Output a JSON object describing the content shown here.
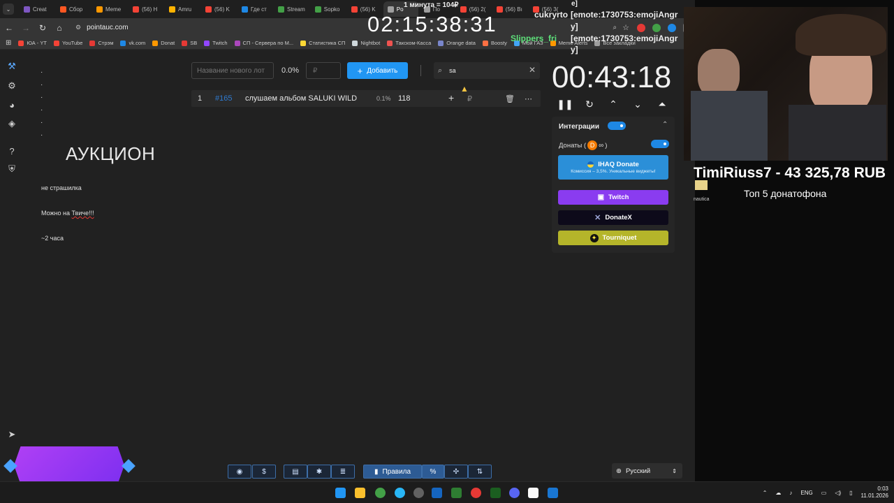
{
  "tabs": [
    {
      "label": "Creat",
      "color": "#7e57c2"
    },
    {
      "label": "Сбор",
      "color": "#ff5722"
    },
    {
      "label": "Meme",
      "color": "#ff9800"
    },
    {
      "label": "(56) H",
      "color": "#f44336"
    },
    {
      "label": "Amru",
      "color": "#ffb300"
    },
    {
      "label": "(56) K",
      "color": "#f44336"
    },
    {
      "label": "Где ст",
      "color": "#1e88e5"
    },
    {
      "label": "Stream",
      "color": "#43a047"
    },
    {
      "label": "Sopko",
      "color": "#43a047"
    },
    {
      "label": "(56) K",
      "color": "#f44336"
    },
    {
      "label": "Po",
      "color": "#9e9e9e"
    },
    {
      "label": "По",
      "color": "#9e9e9e"
    },
    {
      "label": "(56) 2(",
      "color": "#f44336"
    },
    {
      "label": "(56) Bı",
      "color": "#f44336"
    },
    {
      "label": "(56) 3(",
      "color": "#f44336"
    }
  ],
  "address": {
    "url": "pointauc.com"
  },
  "bookmarks": [
    {
      "label": "ЮА - YT",
      "color": "#f44336"
    },
    {
      "label": "YouTube",
      "color": "#f44336"
    },
    {
      "label": "Стрэм",
      "color": "#e53935"
    },
    {
      "label": "vk.com",
      "color": "#1e88e5"
    },
    {
      "label": "Donat",
      "color": "#ff9800"
    },
    {
      "label": "SB",
      "color": "#e53935"
    },
    {
      "label": "Twitch",
      "color": "#9146ff"
    },
    {
      "label": "СП - Сервера по М...",
      "color": "#ab47bc"
    },
    {
      "label": "Статистика СП",
      "color": "#fdd835"
    },
    {
      "label": "Nightbot",
      "color": "#cfd8dc"
    },
    {
      "label": "Такском-Касса",
      "color": "#ef5350"
    },
    {
      "label": "Orange data",
      "color": "#7986cb"
    },
    {
      "label": "Boosty",
      "color": "#ff7043"
    },
    {
      "label": "Мой ГАЗ",
      "color": "#42a5f5"
    },
    {
      "label": "Meme Alerts",
      "color": "#ff9800"
    },
    {
      "label": "Все закладки",
      "color": "#9e9e9e"
    }
  ],
  "description": {
    "title": "АУКЦИОН",
    "line1": "не страшилка",
    "line2a": "Можно на ",
    "line2b": "Твиче!!!",
    "line3": "~2 часа"
  },
  "lot_form": {
    "name_placeholder": "Название нового лот",
    "percent": "0.0%",
    "amount_placeholder": "₽",
    "add_label": "Добавить",
    "search_value": "sa"
  },
  "lots": [
    {
      "index": "1",
      "id": "#165",
      "name": "слушаем альбом SALUKI WILD",
      "percent": "0.1%",
      "amount": "118",
      "currency": "₽"
    }
  ],
  "timer": {
    "value": "00:43:18"
  },
  "integrations": {
    "title": "Интеграции",
    "donations_label": "Донаты (",
    "donations_suffix": ")",
    "services": [
      {
        "label": "IHAQ Donate",
        "sub": "Комиссия – 3,5%. Уникальные виджеты!",
        "color": "#2b8fd8"
      },
      {
        "label": "Twitch",
        "color": "#8a3cf0"
      },
      {
        "label": "DonateX",
        "color": "#0d0a1a"
      },
      {
        "label": "Tourniquet",
        "color": "#b5b52a"
      }
    ]
  },
  "bottom_buttons": {
    "rules_label": "Правила"
  },
  "language": {
    "value": "Русский"
  },
  "overlay": {
    "clock": "02:15:38:31",
    "minute_note": "1 минута = 104₽",
    "donor_line": "TimiRiuss7 - 43 325,78 RUB",
    "top_label": "Топ  5 донатофона",
    "chat_user": "cukryrto",
    "chat_msg1": "[emote:1730753:emojiAngr",
    "chat_msg1b": "y]",
    "chat_user2": "Slippers_fri",
    "chat_msg2": "[emote:1730753:emojiAngr",
    "chat_msg2b": "y]",
    "chat_frag": "e]",
    "side_label": "nautica"
  },
  "taskbar": {
    "lang": "ENG",
    "time": "0:03",
    "date": "11.01.2026"
  }
}
